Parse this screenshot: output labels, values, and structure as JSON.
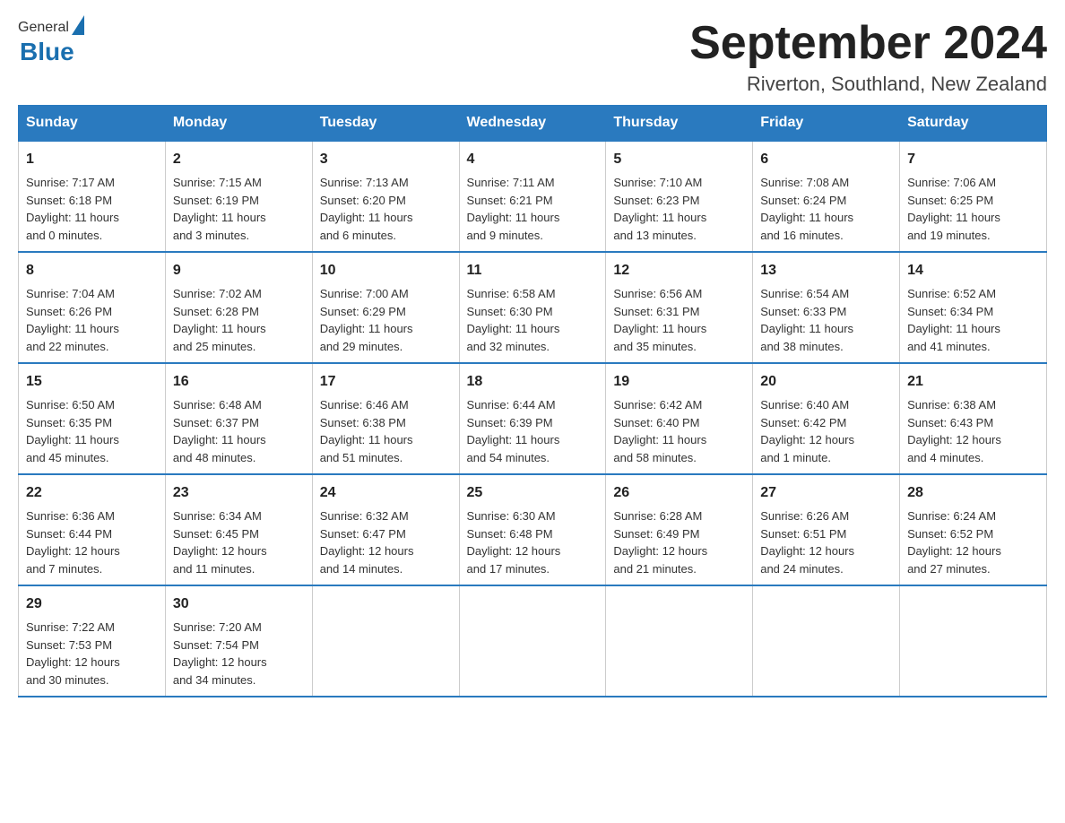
{
  "logo": {
    "general": "General",
    "blue": "Blue"
  },
  "title": "September 2024",
  "subtitle": "Riverton, Southland, New Zealand",
  "weekdays": [
    "Sunday",
    "Monday",
    "Tuesday",
    "Wednesday",
    "Thursday",
    "Friday",
    "Saturday"
  ],
  "weeks": [
    [
      {
        "day": "1",
        "sunrise": "7:17 AM",
        "sunset": "6:18 PM",
        "daylight": "11 hours and 0 minutes."
      },
      {
        "day": "2",
        "sunrise": "7:15 AM",
        "sunset": "6:19 PM",
        "daylight": "11 hours and 3 minutes."
      },
      {
        "day": "3",
        "sunrise": "7:13 AM",
        "sunset": "6:20 PM",
        "daylight": "11 hours and 6 minutes."
      },
      {
        "day": "4",
        "sunrise": "7:11 AM",
        "sunset": "6:21 PM",
        "daylight": "11 hours and 9 minutes."
      },
      {
        "day": "5",
        "sunrise": "7:10 AM",
        "sunset": "6:23 PM",
        "daylight": "11 hours and 13 minutes."
      },
      {
        "day": "6",
        "sunrise": "7:08 AM",
        "sunset": "6:24 PM",
        "daylight": "11 hours and 16 minutes."
      },
      {
        "day": "7",
        "sunrise": "7:06 AM",
        "sunset": "6:25 PM",
        "daylight": "11 hours and 19 minutes."
      }
    ],
    [
      {
        "day": "8",
        "sunrise": "7:04 AM",
        "sunset": "6:26 PM",
        "daylight": "11 hours and 22 minutes."
      },
      {
        "day": "9",
        "sunrise": "7:02 AM",
        "sunset": "6:28 PM",
        "daylight": "11 hours and 25 minutes."
      },
      {
        "day": "10",
        "sunrise": "7:00 AM",
        "sunset": "6:29 PM",
        "daylight": "11 hours and 29 minutes."
      },
      {
        "day": "11",
        "sunrise": "6:58 AM",
        "sunset": "6:30 PM",
        "daylight": "11 hours and 32 minutes."
      },
      {
        "day": "12",
        "sunrise": "6:56 AM",
        "sunset": "6:31 PM",
        "daylight": "11 hours and 35 minutes."
      },
      {
        "day": "13",
        "sunrise": "6:54 AM",
        "sunset": "6:33 PM",
        "daylight": "11 hours and 38 minutes."
      },
      {
        "day": "14",
        "sunrise": "6:52 AM",
        "sunset": "6:34 PM",
        "daylight": "11 hours and 41 minutes."
      }
    ],
    [
      {
        "day": "15",
        "sunrise": "6:50 AM",
        "sunset": "6:35 PM",
        "daylight": "11 hours and 45 minutes."
      },
      {
        "day": "16",
        "sunrise": "6:48 AM",
        "sunset": "6:37 PM",
        "daylight": "11 hours and 48 minutes."
      },
      {
        "day": "17",
        "sunrise": "6:46 AM",
        "sunset": "6:38 PM",
        "daylight": "11 hours and 51 minutes."
      },
      {
        "day": "18",
        "sunrise": "6:44 AM",
        "sunset": "6:39 PM",
        "daylight": "11 hours and 54 minutes."
      },
      {
        "day": "19",
        "sunrise": "6:42 AM",
        "sunset": "6:40 PM",
        "daylight": "11 hours and 58 minutes."
      },
      {
        "day": "20",
        "sunrise": "6:40 AM",
        "sunset": "6:42 PM",
        "daylight": "12 hours and 1 minute."
      },
      {
        "day": "21",
        "sunrise": "6:38 AM",
        "sunset": "6:43 PM",
        "daylight": "12 hours and 4 minutes."
      }
    ],
    [
      {
        "day": "22",
        "sunrise": "6:36 AM",
        "sunset": "6:44 PM",
        "daylight": "12 hours and 7 minutes."
      },
      {
        "day": "23",
        "sunrise": "6:34 AM",
        "sunset": "6:45 PM",
        "daylight": "12 hours and 11 minutes."
      },
      {
        "day": "24",
        "sunrise": "6:32 AM",
        "sunset": "6:47 PM",
        "daylight": "12 hours and 14 minutes."
      },
      {
        "day": "25",
        "sunrise": "6:30 AM",
        "sunset": "6:48 PM",
        "daylight": "12 hours and 17 minutes."
      },
      {
        "day": "26",
        "sunrise": "6:28 AM",
        "sunset": "6:49 PM",
        "daylight": "12 hours and 21 minutes."
      },
      {
        "day": "27",
        "sunrise": "6:26 AM",
        "sunset": "6:51 PM",
        "daylight": "12 hours and 24 minutes."
      },
      {
        "day": "28",
        "sunrise": "6:24 AM",
        "sunset": "6:52 PM",
        "daylight": "12 hours and 27 minutes."
      }
    ],
    [
      {
        "day": "29",
        "sunrise": "7:22 AM",
        "sunset": "7:53 PM",
        "daylight": "12 hours and 30 minutes."
      },
      {
        "day": "30",
        "sunrise": "7:20 AM",
        "sunset": "7:54 PM",
        "daylight": "12 hours and 34 minutes."
      },
      null,
      null,
      null,
      null,
      null
    ]
  ],
  "labels": {
    "sunrise": "Sunrise:",
    "sunset": "Sunset:",
    "daylight": "Daylight:"
  }
}
